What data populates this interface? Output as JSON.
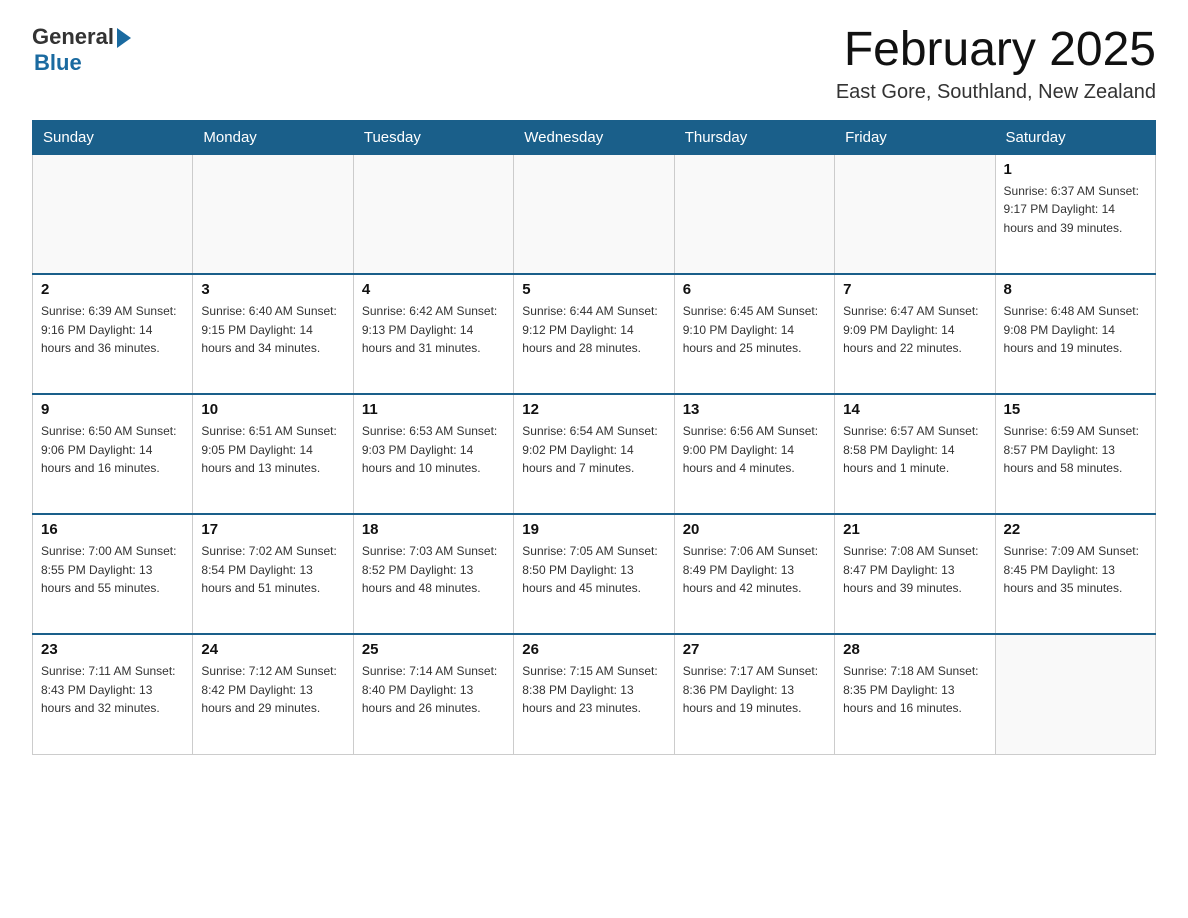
{
  "header": {
    "logo_general": "General",
    "logo_blue": "Blue",
    "title": "February 2025",
    "subtitle": "East Gore, Southland, New Zealand"
  },
  "days_of_week": [
    "Sunday",
    "Monday",
    "Tuesday",
    "Wednesday",
    "Thursday",
    "Friday",
    "Saturday"
  ],
  "weeks": [
    [
      {
        "day": "",
        "info": ""
      },
      {
        "day": "",
        "info": ""
      },
      {
        "day": "",
        "info": ""
      },
      {
        "day": "",
        "info": ""
      },
      {
        "day": "",
        "info": ""
      },
      {
        "day": "",
        "info": ""
      },
      {
        "day": "1",
        "info": "Sunrise: 6:37 AM\nSunset: 9:17 PM\nDaylight: 14 hours\nand 39 minutes."
      }
    ],
    [
      {
        "day": "2",
        "info": "Sunrise: 6:39 AM\nSunset: 9:16 PM\nDaylight: 14 hours\nand 36 minutes."
      },
      {
        "day": "3",
        "info": "Sunrise: 6:40 AM\nSunset: 9:15 PM\nDaylight: 14 hours\nand 34 minutes."
      },
      {
        "day": "4",
        "info": "Sunrise: 6:42 AM\nSunset: 9:13 PM\nDaylight: 14 hours\nand 31 minutes."
      },
      {
        "day": "5",
        "info": "Sunrise: 6:44 AM\nSunset: 9:12 PM\nDaylight: 14 hours\nand 28 minutes."
      },
      {
        "day": "6",
        "info": "Sunrise: 6:45 AM\nSunset: 9:10 PM\nDaylight: 14 hours\nand 25 minutes."
      },
      {
        "day": "7",
        "info": "Sunrise: 6:47 AM\nSunset: 9:09 PM\nDaylight: 14 hours\nand 22 minutes."
      },
      {
        "day": "8",
        "info": "Sunrise: 6:48 AM\nSunset: 9:08 PM\nDaylight: 14 hours\nand 19 minutes."
      }
    ],
    [
      {
        "day": "9",
        "info": "Sunrise: 6:50 AM\nSunset: 9:06 PM\nDaylight: 14 hours\nand 16 minutes."
      },
      {
        "day": "10",
        "info": "Sunrise: 6:51 AM\nSunset: 9:05 PM\nDaylight: 14 hours\nand 13 minutes."
      },
      {
        "day": "11",
        "info": "Sunrise: 6:53 AM\nSunset: 9:03 PM\nDaylight: 14 hours\nand 10 minutes."
      },
      {
        "day": "12",
        "info": "Sunrise: 6:54 AM\nSunset: 9:02 PM\nDaylight: 14 hours\nand 7 minutes."
      },
      {
        "day": "13",
        "info": "Sunrise: 6:56 AM\nSunset: 9:00 PM\nDaylight: 14 hours\nand 4 minutes."
      },
      {
        "day": "14",
        "info": "Sunrise: 6:57 AM\nSunset: 8:58 PM\nDaylight: 14 hours\nand 1 minute."
      },
      {
        "day": "15",
        "info": "Sunrise: 6:59 AM\nSunset: 8:57 PM\nDaylight: 13 hours\nand 58 minutes."
      }
    ],
    [
      {
        "day": "16",
        "info": "Sunrise: 7:00 AM\nSunset: 8:55 PM\nDaylight: 13 hours\nand 55 minutes."
      },
      {
        "day": "17",
        "info": "Sunrise: 7:02 AM\nSunset: 8:54 PM\nDaylight: 13 hours\nand 51 minutes."
      },
      {
        "day": "18",
        "info": "Sunrise: 7:03 AM\nSunset: 8:52 PM\nDaylight: 13 hours\nand 48 minutes."
      },
      {
        "day": "19",
        "info": "Sunrise: 7:05 AM\nSunset: 8:50 PM\nDaylight: 13 hours\nand 45 minutes."
      },
      {
        "day": "20",
        "info": "Sunrise: 7:06 AM\nSunset: 8:49 PM\nDaylight: 13 hours\nand 42 minutes."
      },
      {
        "day": "21",
        "info": "Sunrise: 7:08 AM\nSunset: 8:47 PM\nDaylight: 13 hours\nand 39 minutes."
      },
      {
        "day": "22",
        "info": "Sunrise: 7:09 AM\nSunset: 8:45 PM\nDaylight: 13 hours\nand 35 minutes."
      }
    ],
    [
      {
        "day": "23",
        "info": "Sunrise: 7:11 AM\nSunset: 8:43 PM\nDaylight: 13 hours\nand 32 minutes."
      },
      {
        "day": "24",
        "info": "Sunrise: 7:12 AM\nSunset: 8:42 PM\nDaylight: 13 hours\nand 29 minutes."
      },
      {
        "day": "25",
        "info": "Sunrise: 7:14 AM\nSunset: 8:40 PM\nDaylight: 13 hours\nand 26 minutes."
      },
      {
        "day": "26",
        "info": "Sunrise: 7:15 AM\nSunset: 8:38 PM\nDaylight: 13 hours\nand 23 minutes."
      },
      {
        "day": "27",
        "info": "Sunrise: 7:17 AM\nSunset: 8:36 PM\nDaylight: 13 hours\nand 19 minutes."
      },
      {
        "day": "28",
        "info": "Sunrise: 7:18 AM\nSunset: 8:35 PM\nDaylight: 13 hours\nand 16 minutes."
      },
      {
        "day": "",
        "info": ""
      }
    ]
  ]
}
